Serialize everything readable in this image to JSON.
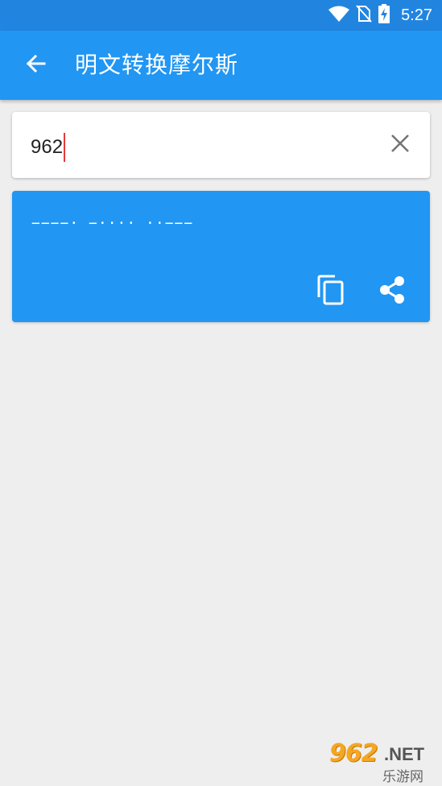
{
  "status_bar": {
    "time": "5:27",
    "icons": [
      "wifi-icon",
      "no-sim-icon",
      "battery-charging-icon"
    ]
  },
  "app_bar": {
    "title": "明文转换摩尔斯",
    "back_icon": "arrow-back-icon"
  },
  "input": {
    "value": "962",
    "clear_icon": "close-icon"
  },
  "output": {
    "morse": "−−−−· −···· ··−−−",
    "copy_icon": "copy-icon",
    "share_icon": "share-icon"
  },
  "watermark": {
    "logo": "962",
    "suffix": ".NET",
    "name": "乐游网"
  },
  "colors": {
    "status_bar": "#2185e0",
    "primary": "#2196f3",
    "background": "#eeeeee",
    "caret": "#e53935"
  }
}
